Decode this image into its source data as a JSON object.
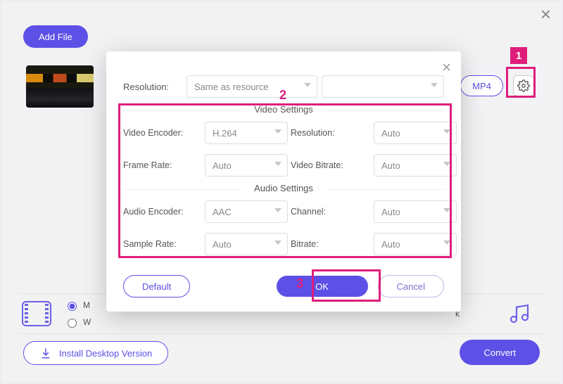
{
  "topbar": {
    "add_file": "Add File"
  },
  "file_row": {
    "format_chip": "MP4"
  },
  "bottom": {
    "radio_a": "M",
    "radio_b": "W",
    "trunc": "k",
    "install": "Install Desktop Version",
    "convert": "Convert"
  },
  "modal": {
    "resolution_label": "Resolution:",
    "resolution_value": "Same as resource",
    "video_section": "Video Settings",
    "audio_section": "Audio Settings",
    "fields": {
      "video_encoder_label": "Video Encoder:",
      "video_encoder_value": "H.264",
      "frame_rate_label": "Frame Rate:",
      "frame_rate_value": "Auto",
      "v_resolution_label": "Resolution:",
      "v_resolution_value": "Auto",
      "video_bitrate_label": "Video Bitrate:",
      "video_bitrate_value": "Auto",
      "audio_encoder_label": "Audio Encoder:",
      "audio_encoder_value": "AAC",
      "sample_rate_label": "Sample Rate:",
      "sample_rate_value": "Auto",
      "channel_label": "Channel:",
      "channel_value": "Auto",
      "a_bitrate_label": "Bitrate:",
      "a_bitrate_value": "Auto"
    },
    "buttons": {
      "default": "Default",
      "ok": "OK",
      "cancel": "Cancel"
    }
  },
  "annotations": {
    "n1": "1",
    "n2": "2",
    "n3": "3"
  }
}
